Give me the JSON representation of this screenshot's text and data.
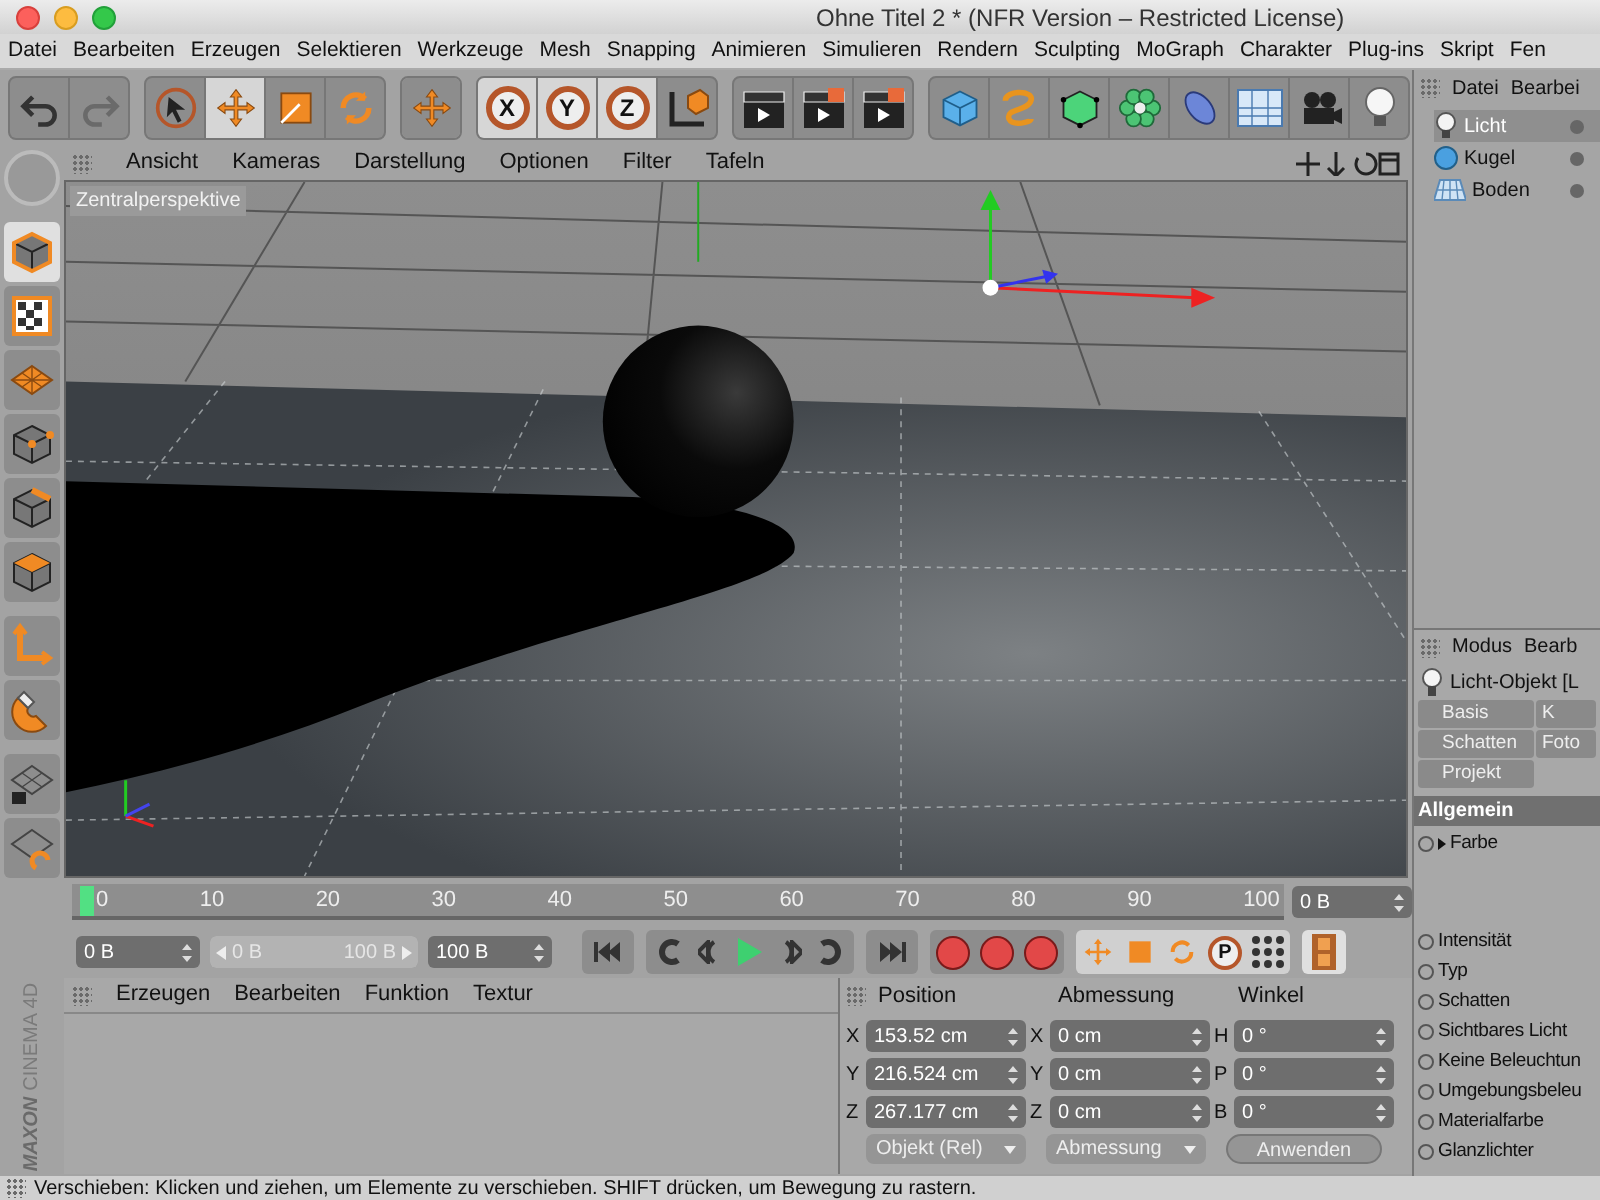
{
  "window": {
    "title": "Ohne Titel 2 * (NFR Version – Restricted License)"
  },
  "menu_bar": [
    "Datei",
    "Bearbeiten",
    "Erzeugen",
    "Selektieren",
    "Werkzeuge",
    "Mesh",
    "Snapping",
    "Animieren",
    "Simulieren",
    "Rendern",
    "Sculpting",
    "MoGraph",
    "Charakter",
    "Plug-ins",
    "Skript",
    "Fen"
  ],
  "main_toolbar": [
    {
      "selected": false
    },
    {
      "selected": false
    },
    {
      "selected": false
    },
    {
      "selected": true
    },
    {
      "selected": false
    },
    {
      "selected": false
    },
    {
      "selected": false
    }
  ],
  "axis_locks": [
    {
      "label": "X",
      "selected": true
    },
    {
      "label": "Y",
      "selected": true
    },
    {
      "label": "Z",
      "selected": true
    }
  ],
  "left_toolbar": [
    {
      "selected": true
    },
    {
      "selected": false
    },
    {
      "selected": false
    },
    {
      "selected": false
    },
    {
      "selected": false
    },
    {
      "selected": false
    },
    {
      "selected": false
    },
    {
      "selected": false
    },
    {
      "selected": false
    },
    {
      "selected": false
    }
  ],
  "viewport": {
    "menu": [
      "Ansicht",
      "Kameras",
      "Darstellung",
      "Optionen",
      "Filter",
      "Tafeln"
    ],
    "camera_label": "Zentralperspektive"
  },
  "timeline": {
    "ticks": [
      "0",
      "10",
      "20",
      "30",
      "40",
      "50",
      "60",
      "70",
      "80",
      "90",
      "100"
    ],
    "playhead": {
      "level": 0
    },
    "current_frame": "0 B"
  },
  "transport": {
    "start_field": "0 B",
    "range_slider": {
      "start": "0 B",
      "end": "100 B",
      "level": 1
    },
    "end_field": "100 B",
    "param_button": "P"
  },
  "material_manager": {
    "menu": [
      "Erzeugen",
      "Bearbeiten",
      "Funktion",
      "Textur"
    ]
  },
  "coordinates": {
    "headers": [
      "Position",
      "Abmessung",
      "Winkel"
    ],
    "rows": [
      [
        {
          "axis": "X",
          "value": "153.52 cm"
        },
        {
          "axis": "X",
          "value": "0 cm"
        },
        {
          "axis": "H",
          "value": "0 °"
        }
      ],
      [
        {
          "axis": "Y",
          "value": "216.524 cm"
        },
        {
          "axis": "Y",
          "value": "0 cm"
        },
        {
          "axis": "P",
          "value": "0 °"
        }
      ],
      [
        {
          "axis": "Z",
          "value": "267.177 cm"
        },
        {
          "axis": "Z",
          "value": "0 cm"
        },
        {
          "axis": "B",
          "value": "0 °"
        }
      ]
    ],
    "dropdowns": [
      "Objekt (Rel)",
      "Abmessung"
    ],
    "apply_button": "Anwenden"
  },
  "logo": {
    "brand": "MAXON",
    "product": "CINEMA 4D"
  },
  "object_manager": {
    "menu": [
      "Datei",
      "Bearbei"
    ],
    "objects": [
      {
        "name": "Licht",
        "kind": "light",
        "selected": true
      },
      {
        "name": "Kugel",
        "kind": "sphere",
        "selected": false
      },
      {
        "name": "Boden",
        "kind": "floor",
        "selected": false
      }
    ]
  },
  "attribute_manager": {
    "menu": [
      "Modus",
      "Bearb"
    ],
    "title": "Licht-Objekt [L",
    "tabs": [
      {
        "label": "Basis",
        "selected": false
      },
      {
        "label": "K",
        "selected": false
      },
      {
        "label": "Schatten",
        "selected": false
      },
      {
        "label": "Foto",
        "selected": false
      },
      {
        "label": "Projekt",
        "selected": false
      }
    ],
    "section": "Allgemein",
    "params": [
      {
        "label": "Farbe",
        "kind": "expandable"
      },
      {
        "label": "Intensität",
        "kind": "plain"
      },
      {
        "label": "Typ",
        "kind": "plain"
      },
      {
        "label": "Schatten",
        "kind": "plain"
      },
      {
        "label": "Sichtbares Licht",
        "kind": "plain"
      },
      {
        "label": "Keine Beleuchtun",
        "kind": "plain"
      },
      {
        "label": "Umgebungsbeleu",
        "kind": "plain"
      },
      {
        "label": "Materialfarbe",
        "kind": "plain"
      },
      {
        "label": "Glanzlichter",
        "kind": "plain"
      }
    ]
  },
  "status_bar": "Verschieben: Klicken und ziehen, um Elemente zu verschieben. SHIFT drücken, um Bewegung zu rastern."
}
